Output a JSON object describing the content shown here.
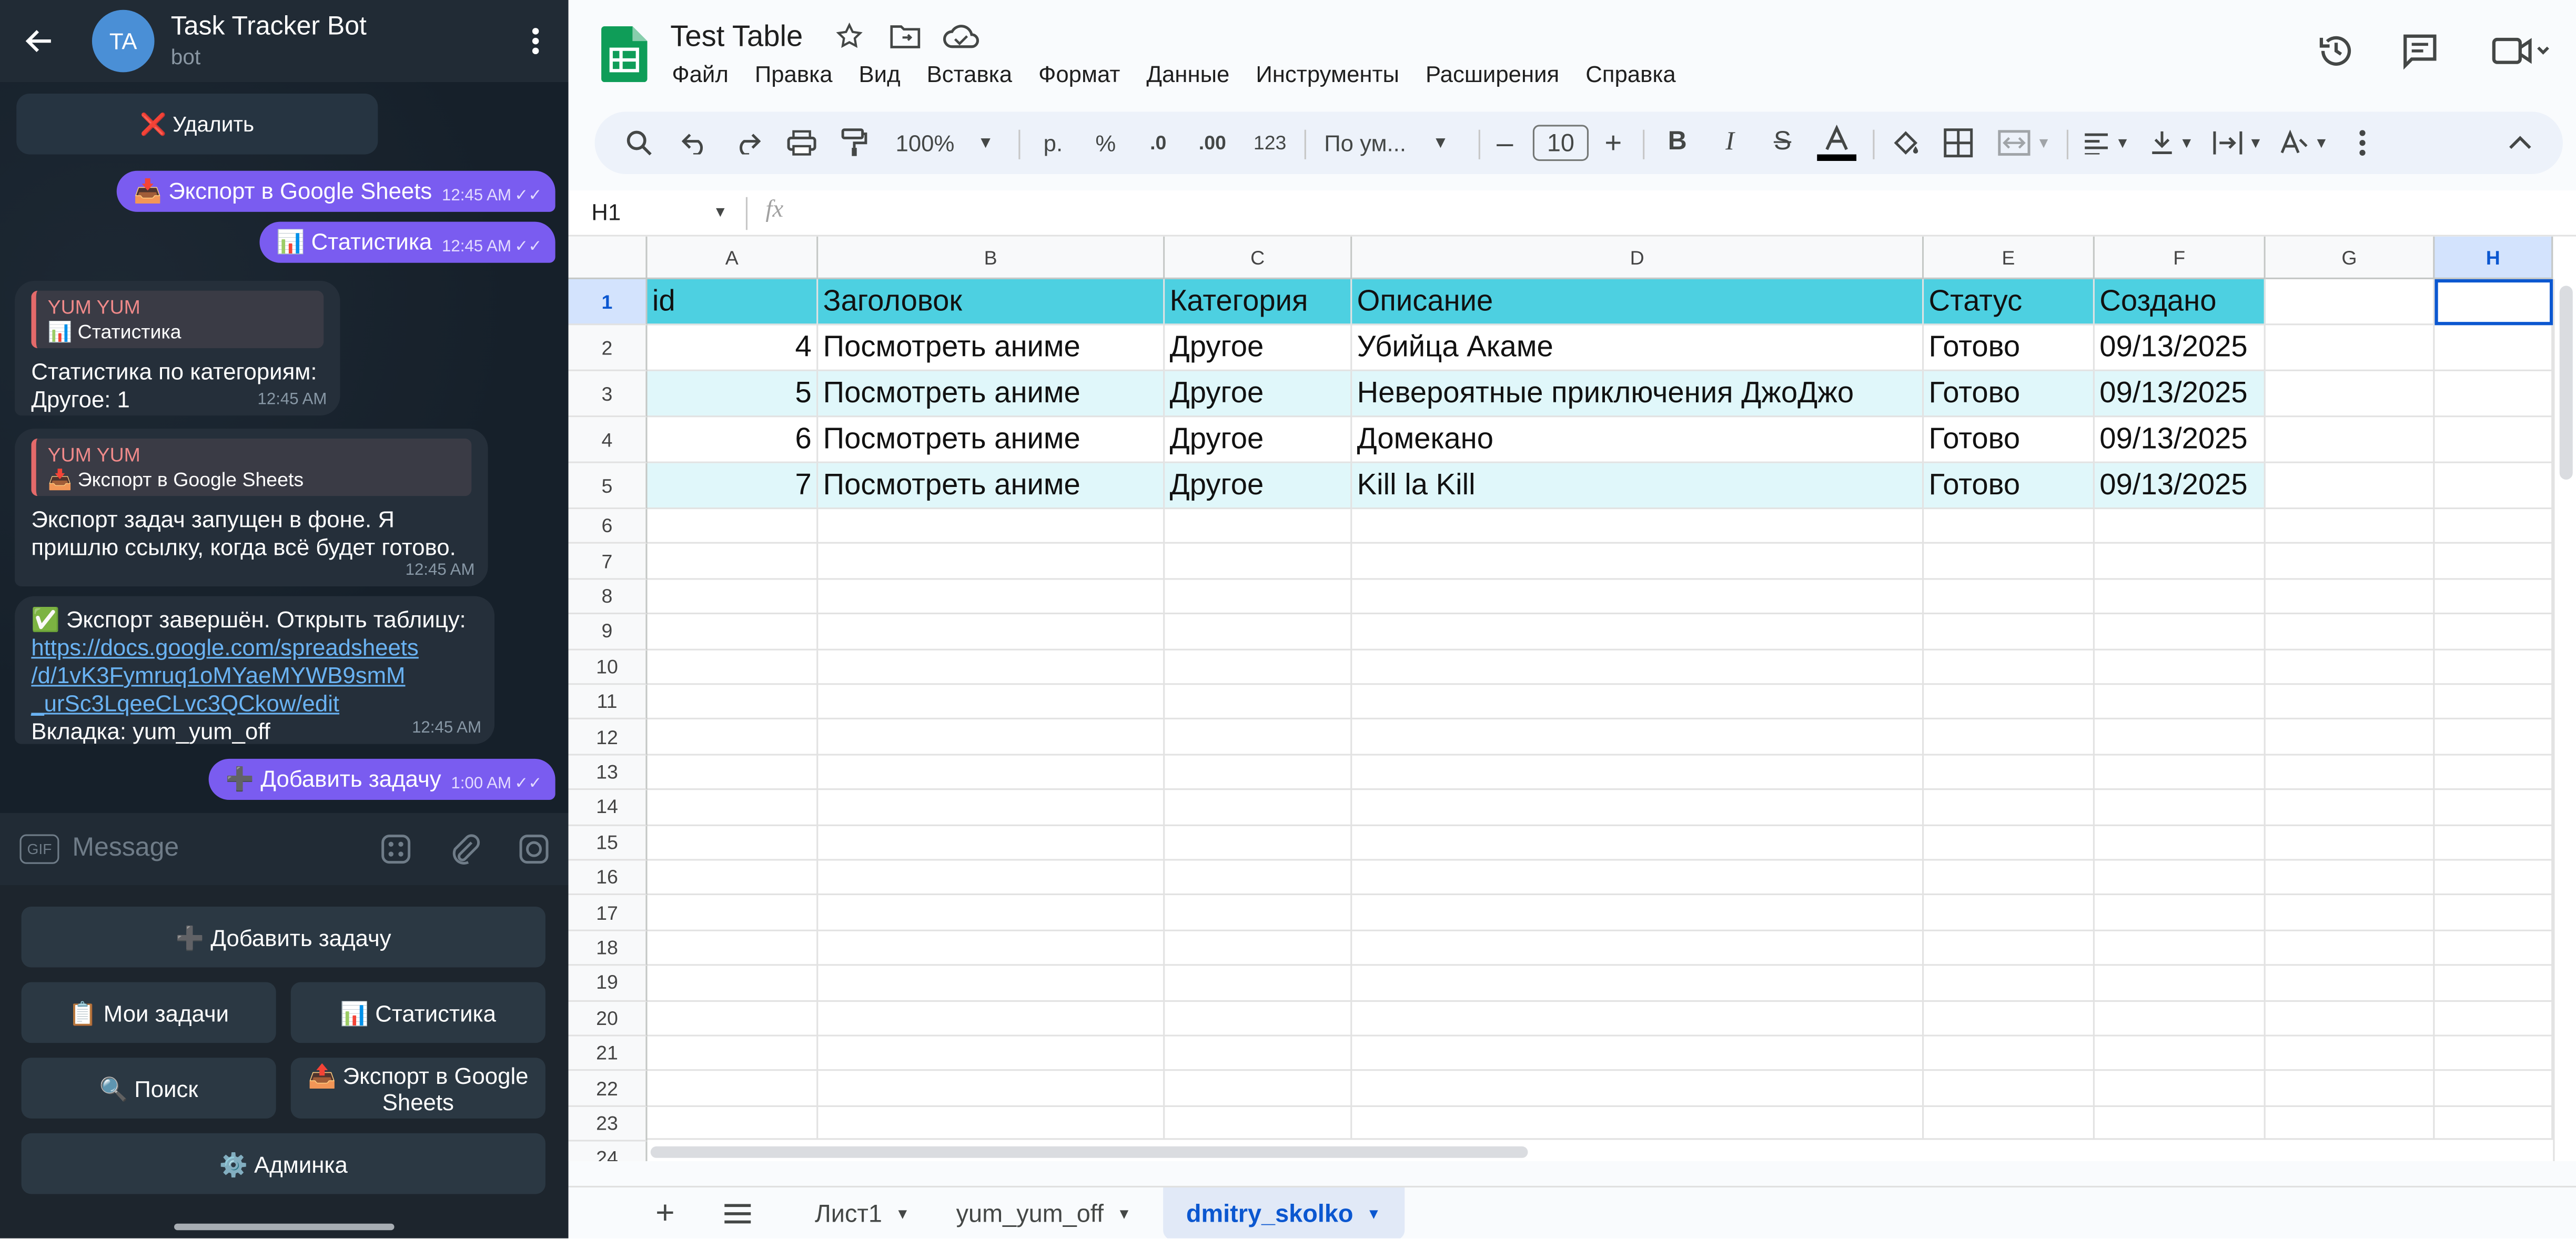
{
  "telegram": {
    "chat_title": "Task Tracker Bot",
    "chat_subtitle": "bot",
    "avatar_initials": "TA",
    "delete_button": "❌ Удалить",
    "messages": {
      "out1": {
        "text": "📥 Экспорт в Google Sheets",
        "time": "12:45 AM"
      },
      "out2": {
        "text": "📊 Статистика",
        "time": "12:45 AM"
      },
      "in1": {
        "quote_author": "YUM YUM",
        "quote_text": "📊 Статистика",
        "lines": [
          "Статистика по категориям:",
          "Другое: 1"
        ],
        "time": "12:45 AM"
      },
      "in2": {
        "quote_author": "YUM YUM",
        "quote_text": "📥 Экспорт в Google Sheets",
        "lines": [
          "Экспорт задач запущен в фоне. Я",
          "пришлю ссылку, когда всё будет готово."
        ],
        "time": "12:45 AM"
      },
      "in3": {
        "line1": "✅ Экспорт завершён. Открыть таблицу:",
        "link_lines": [
          "https://docs.google.com/spreadsheets",
          "/d/1vK3Fymruq1oMYaeMYWB9smM",
          "_urSc3LqeeCLvc3QCkow/edit"
        ],
        "line_last": "Вкладка: yum_yum_off",
        "time": "12:45 AM"
      },
      "out3": {
        "text": "➕ Добавить задачу",
        "time": "1:00 AM"
      }
    },
    "input_placeholder": "Message",
    "gif_label": "GIF",
    "keyboard": {
      "add_task": "➕ Добавить задачу",
      "my_tasks": "📋 Мои задачи",
      "stats": "📊 Статистика",
      "search": "🔍 Поиск",
      "export_1": "📤 Экспорт в Google",
      "export_2": "Sheets",
      "admin": "⚙️ Админка"
    }
  },
  "sheets": {
    "doc_title": "Test Table",
    "menus": [
      "Файл",
      "Правка",
      "Вид",
      "Вставка",
      "Формат",
      "Данные",
      "Инструменты",
      "Расширения",
      "Справка"
    ],
    "toolbar": {
      "zoom": "100%",
      "currency": "р.",
      "percent": "%",
      "dec_decrease": ".0",
      "dec_increase": ".00",
      "format_123": "123",
      "font": "По ум...",
      "font_size": "10",
      "bold": "B",
      "italic": "I",
      "strike": "S"
    },
    "name_box": "H1",
    "fx": "fx",
    "columns": [
      "A",
      "B",
      "C",
      "D",
      "E",
      "F",
      "G",
      "H"
    ],
    "header_row": [
      "id",
      "Заголовок",
      "Категория",
      "Описание",
      "Статус",
      "Создано"
    ],
    "rows": [
      [
        "4",
        "Посмотреть аниме",
        "Другое",
        "Убийца Акаме",
        "Готово",
        "09/13/2025"
      ],
      [
        "5",
        "Посмотреть аниме",
        "Другое",
        "Невероятные приключения ДжоДжо",
        "Готово",
        "09/13/2025"
      ],
      [
        "6",
        "Посмотреть аниме",
        "Другое",
        "Домекано",
        "Готово",
        "09/13/2025"
      ],
      [
        "7",
        "Посмотреть аниме",
        "Другое",
        "Kill la Kill",
        "Готово",
        "09/13/2025"
      ]
    ],
    "row_numbers": [
      "1",
      "2",
      "3",
      "4",
      "5",
      "6",
      "7",
      "8",
      "9",
      "10",
      "11",
      "12",
      "13",
      "14",
      "15",
      "16",
      "17",
      "18",
      "19",
      "20",
      "21",
      "22",
      "23",
      "24"
    ],
    "tabs": [
      "Лист1",
      "yum_yum_off",
      "dmitry_skolko"
    ],
    "colors": {
      "header_fill": "#4dd0e1",
      "band_fill": "#e0f7fa",
      "active_tab": "#0b57d0"
    }
  }
}
